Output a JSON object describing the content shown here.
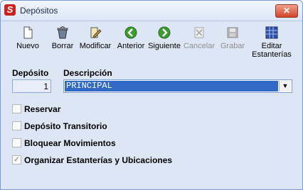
{
  "window": {
    "title": "Depósitos",
    "close_icon": "close-icon",
    "app_icon": "app-s-icon",
    "app_icon_glyph": "S"
  },
  "toolbar": {
    "buttons": [
      {
        "label": "Nuevo",
        "icon": "new-document-icon",
        "enabled": true
      },
      {
        "label": "Borrar",
        "icon": "trash-icon",
        "enabled": true
      },
      {
        "label": "Modificar",
        "icon": "edit-document-icon",
        "enabled": true
      },
      {
        "label": "Anterior",
        "icon": "previous-arrow-icon",
        "enabled": true
      },
      {
        "label": "Siguiente",
        "icon": "next-arrow-icon",
        "enabled": true
      },
      {
        "label": "Cancelar",
        "icon": "cancel-icon",
        "enabled": false
      },
      {
        "label": "Grabar",
        "icon": "save-disk-icon",
        "enabled": false
      },
      {
        "label": "Editar Estanterías",
        "icon": "grid-icon",
        "enabled": true
      }
    ]
  },
  "form": {
    "deposito_label": "Depósito",
    "deposito_value": "1",
    "descripcion_label": "Descripción",
    "descripcion_value": "PRINCIPAL"
  },
  "checkboxes": [
    {
      "label": "Reservar",
      "checked": false,
      "enabled": true
    },
    {
      "label": "Depósito Transitorio",
      "checked": false,
      "enabled": true
    },
    {
      "label": "Bloquear Movimientos",
      "checked": false,
      "enabled": true
    },
    {
      "label": "Organizar Estanterías y Ubicaciones",
      "checked": true,
      "enabled": false
    }
  ],
  "colors": {
    "accent": "#3169c6",
    "window_bg": "#dde6f4",
    "green_nav": "#3c9b2f"
  }
}
